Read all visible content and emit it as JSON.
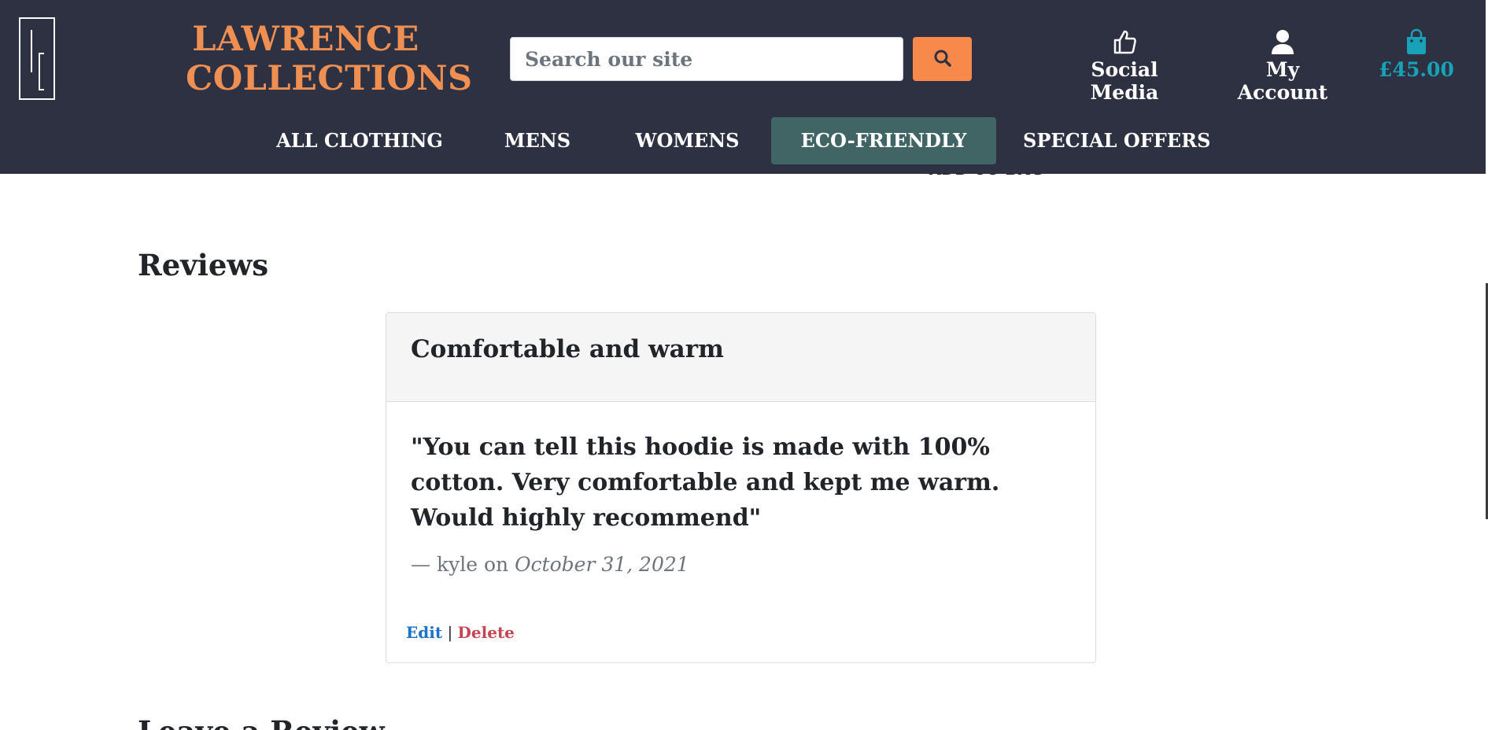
{
  "header": {
    "brand_line1": "LAWRENCE",
    "brand_line2": "COLLECTIONS",
    "search_placeholder": "Search our site",
    "social_label": "Social Media",
    "account_label": "My Account",
    "bag_total": "£45.00"
  },
  "nav": {
    "items": [
      {
        "label": "ALL CLOTHING"
      },
      {
        "label": "MENS"
      },
      {
        "label": "WOMENS"
      },
      {
        "label": "ECO-FRIENDLY",
        "active": true
      },
      {
        "label": "SPECIAL OFFERS"
      }
    ]
  },
  "product": {
    "add_to_bag_label": "ADD TO BAG"
  },
  "reviews": {
    "heading": "Reviews",
    "items": [
      {
        "title": "Comfortable and warm",
        "text": "\"You can tell this hoodie is made with 100% cotton. Very comfortable and kept me warm. Would highly recommend\"",
        "author_prefix": "— kyle on ",
        "date": "October 31, 2021",
        "edit_label": "Edit",
        "separator": "|",
        "delete_label": "Delete"
      }
    ],
    "leave_review_heading": "Leave a Review"
  },
  "colors": {
    "header_bg": "#2d3142",
    "brand": "#ef8f52",
    "search_button": "#f7894a",
    "bag": "#17a2b8",
    "active_nav": "#416464",
    "edit": "#1a73c8",
    "delete": "#c64552"
  },
  "icons": {
    "logo": "lc-logo-icon",
    "search": "search-icon",
    "social": "thumbs-up-icon",
    "account": "user-icon",
    "bag": "shopping-bag-icon"
  }
}
